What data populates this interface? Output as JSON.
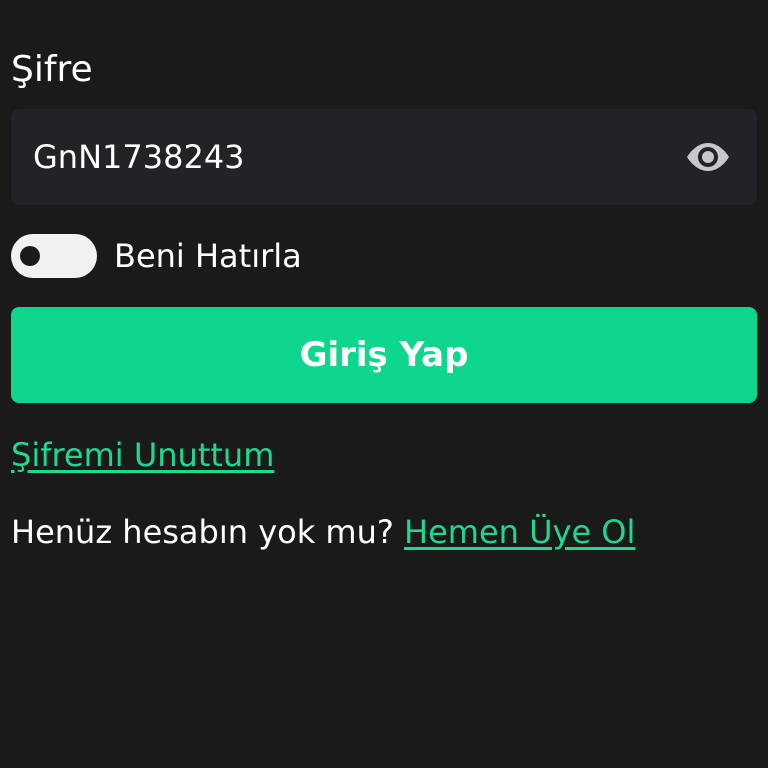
{
  "password": {
    "label": "Şifre",
    "value": "GnN1738243",
    "visibility_icon": "eye-icon"
  },
  "remember_me": {
    "label": "Beni Hatırla",
    "enabled": false
  },
  "login_button": {
    "label": "Giriş Yap"
  },
  "forgot_password": {
    "label": "Şifremi Unuttum"
  },
  "signup": {
    "prompt": "Henüz hesabın yok mu?",
    "link_label": "Hemen Üye Ol"
  },
  "colors": {
    "background": "#1a1a1a",
    "field_background": "#222327",
    "accent": "#0ed68c",
    "link": "#1fd88f",
    "text": "#ffffff",
    "icon": "#c8c8c8"
  }
}
